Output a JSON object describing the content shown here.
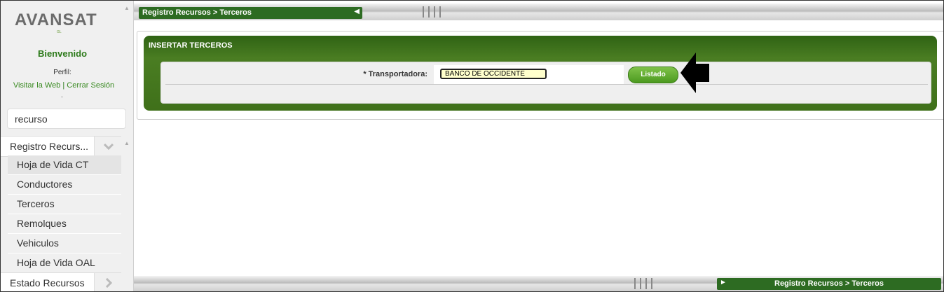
{
  "brand": {
    "logo_text": "AVANSAT",
    "logo_sub": "GL"
  },
  "sidebar": {
    "welcome": "Bienvenido",
    "perfil_label": "Perfil:",
    "link_web": "Visitar la Web",
    "link_sep": " | ",
    "link_logout": "Cerrar Sesión",
    "dot": ".",
    "search_value": "recurso",
    "menu": [
      {
        "label": "Registro Recurs...",
        "type": "header",
        "expanded": true
      },
      {
        "label": "Hoja de Vida CT",
        "type": "item",
        "active": true
      },
      {
        "label": "Conductores",
        "type": "item"
      },
      {
        "label": "Terceros",
        "type": "item"
      },
      {
        "label": "Remolques",
        "type": "item"
      },
      {
        "label": "Vehiculos",
        "type": "item"
      },
      {
        "label": "Hoja de Vida OAL",
        "type": "item"
      },
      {
        "label": "Estado Recursos",
        "type": "header",
        "expanded": false
      }
    ]
  },
  "topbar": {
    "breadcrumb": "Registro Recursos > Terceros"
  },
  "form": {
    "title": "INSERTAR TERCEROS",
    "transportadora_label": "* Transportadora:",
    "transportadora_value": "BANCO DE OCCIDENTE",
    "listado_button": "Listado"
  },
  "bottombar": {
    "breadcrumb": "Registro Recursos > Terceros"
  },
  "colors": {
    "accent_green": "#2d6b22",
    "input_bg": "#ffffcc"
  }
}
